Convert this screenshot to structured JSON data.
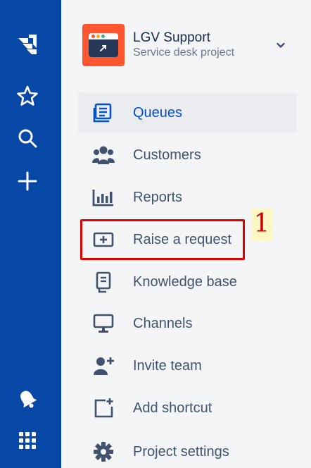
{
  "project": {
    "name": "LGV Support",
    "type": "Service desk project",
    "avatar_color": "#ff5630"
  },
  "rail": {
    "background": "#0747a6",
    "icons": [
      "jira-logo-icon",
      "star-icon",
      "search-icon",
      "plus-icon",
      "notification-icon",
      "app-switcher-icon"
    ]
  },
  "nav": {
    "items": [
      {
        "label": "Queues",
        "icon": "queues-icon",
        "active": true
      },
      {
        "label": "Customers",
        "icon": "customers-icon"
      },
      {
        "label": "Reports",
        "icon": "reports-icon"
      },
      {
        "label": "Raise a request",
        "icon": "raise-request-icon"
      },
      {
        "label": "Knowledge base",
        "icon": "knowledge-base-icon"
      },
      {
        "label": "Channels",
        "icon": "channels-icon"
      },
      {
        "label": "Invite team",
        "icon": "invite-team-icon"
      },
      {
        "label": "Add shortcut",
        "icon": "add-shortcut-icon"
      },
      {
        "label": "Project settings",
        "icon": "project-settings-icon"
      }
    ]
  },
  "annotation": {
    "marker_label": "1",
    "highlight_color": "#e00000"
  }
}
